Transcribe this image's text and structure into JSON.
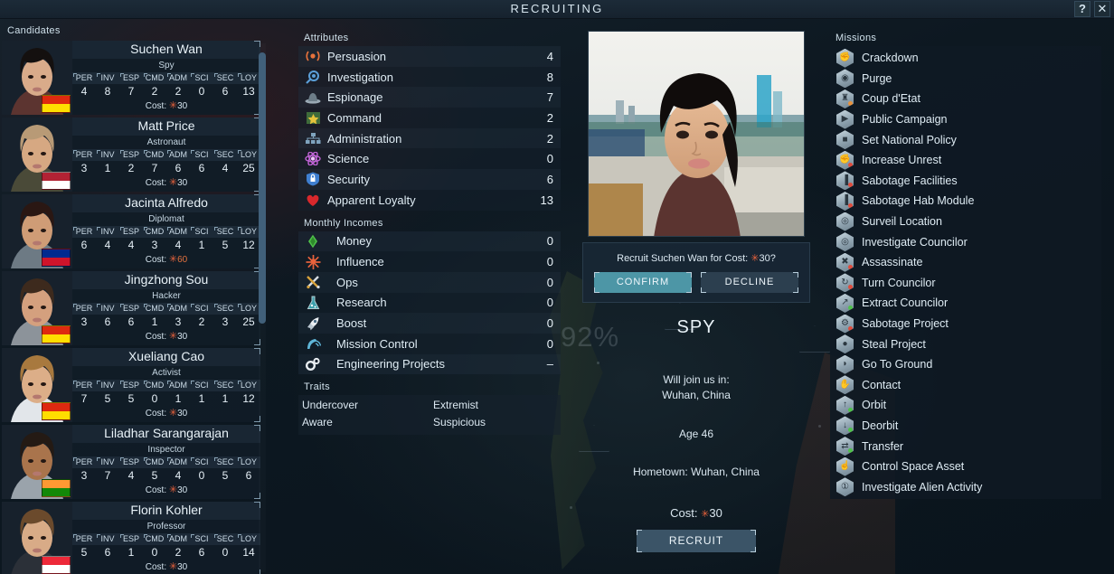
{
  "window": {
    "title": "RECRUITING",
    "help_label": "?",
    "close_label": "✕"
  },
  "candidates_panel": {
    "label": "Candidates",
    "cost_prefix": "Cost:",
    "stat_headers": [
      "PER",
      "INV",
      "ESP",
      "CMD",
      "ADM",
      "SCI",
      "SEC",
      "LOY"
    ],
    "items": [
      {
        "name": "Suchen Wan",
        "role": "Spy",
        "stats": [
          4,
          8,
          7,
          2,
          2,
          0,
          6,
          13
        ],
        "cost": "30",
        "cost_highlight": false,
        "flag": "China",
        "flag_colors": [
          "#de2910",
          "#ffde00"
        ],
        "hair": "#14100f",
        "skin": "#d9ab8a",
        "clothes": "#5c3430"
      },
      {
        "name": "Matt Price",
        "role": "Astronaut",
        "stats": [
          3,
          1,
          2,
          7,
          6,
          6,
          4,
          25
        ],
        "cost": "30",
        "cost_highlight": false,
        "flag": "United States",
        "flag_colors": [
          "#b22234",
          "#ffffff"
        ],
        "hair": "#b89a76",
        "skin": "#d6a882",
        "clothes": "#4a4a38"
      },
      {
        "name": "Jacinta Alfredo",
        "role": "Diplomat",
        "stats": [
          6,
          4,
          4,
          3,
          4,
          1,
          5,
          12
        ],
        "cost": "60",
        "cost_highlight": true,
        "flag": "Cuba",
        "flag_colors": [
          "#002a8f",
          "#cf142b"
        ],
        "hair": "#2a1713",
        "skin": "#cf9c76",
        "clothes": "#6d7a84"
      },
      {
        "name": "Jingzhong Sou",
        "role": "Hacker",
        "stats": [
          3,
          6,
          6,
          1,
          3,
          2,
          3,
          25
        ],
        "cost": "30",
        "cost_highlight": false,
        "flag": "China",
        "flag_colors": [
          "#de2910",
          "#ffde00"
        ],
        "hair": "#3d2a1d",
        "skin": "#d4a07e",
        "clothes": "#8c939a"
      },
      {
        "name": "Xueliang Cao",
        "role": "Activist",
        "stats": [
          7,
          5,
          5,
          0,
          1,
          1,
          1,
          12
        ],
        "cost": "30",
        "cost_highlight": false,
        "flag": "China",
        "flag_colors": [
          "#de2910",
          "#ffde00"
        ],
        "hair": "#a8793e",
        "skin": "#dcae88",
        "clothes": "#e2e6ea"
      },
      {
        "name": "Liladhar Sarangarajan",
        "role": "Inspector",
        "stats": [
          3,
          7,
          4,
          5,
          4,
          0,
          5,
          6
        ],
        "cost": "30",
        "cost_highlight": false,
        "flag": "India",
        "flag_colors": [
          "#ff9933",
          "#138808"
        ],
        "hair": "#241a14",
        "skin": "#a9744c",
        "clothes": "#9aa3ab"
      },
      {
        "name": "Florin Kohler",
        "role": "Professor",
        "stats": [
          5,
          6,
          1,
          0,
          2,
          6,
          0,
          14
        ],
        "cost": "30",
        "cost_highlight": false,
        "flag": "Austria",
        "flag_colors": [
          "#ed2939",
          "#ffffff"
        ],
        "hair": "#6b4a2c",
        "skin": "#d8ab87",
        "clothes": "#2b3038"
      }
    ]
  },
  "attributes_panel": {
    "label": "Attributes",
    "items": [
      {
        "name": "Persuasion",
        "value": 4,
        "icon": "broadcast-icon",
        "color": "#e8733c"
      },
      {
        "name": "Investigation",
        "value": 8,
        "icon": "magnifier-icon",
        "color": "#5b9fd8"
      },
      {
        "name": "Espionage",
        "value": 7,
        "icon": "spy-hat-icon",
        "color": "#9aa9b4"
      },
      {
        "name": "Command",
        "value": 2,
        "icon": "star-badge-icon",
        "color": "#e5c33c"
      },
      {
        "name": "Administration",
        "value": 2,
        "icon": "org-chart-icon",
        "color": "#7fa3bd"
      },
      {
        "name": "Science",
        "value": 0,
        "icon": "atom-icon",
        "color": "#c064d6"
      },
      {
        "name": "Security",
        "value": 6,
        "icon": "lock-shield-icon",
        "color": "#3f7fd0"
      },
      {
        "name": "Apparent Loyalty",
        "value": 13,
        "icon": "heart-icon",
        "color": "#d8282c"
      }
    ]
  },
  "incomes_panel": {
    "label": "Monthly Incomes",
    "items": [
      {
        "name": "Money",
        "value": "0",
        "icon": "money-icon",
        "color": "#4fc24a"
      },
      {
        "name": "Influence",
        "value": "0",
        "icon": "influence-star-icon",
        "color": "#e8623c"
      },
      {
        "name": "Ops",
        "value": "0",
        "icon": "crossed-blades-icon",
        "color": "#d8a23a"
      },
      {
        "name": "Research",
        "value": "0",
        "icon": "flask-icon",
        "color": "#44b8c4"
      },
      {
        "name": "Boost",
        "value": "0",
        "icon": "rocket-icon",
        "color": "#e9eef2"
      },
      {
        "name": "Mission Control",
        "value": "0",
        "icon": "satellite-dish-icon",
        "color": "#5fb6d8"
      },
      {
        "name": "Engineering Projects",
        "value": "–",
        "icon": "gears-icon",
        "color": "#e9eef2"
      }
    ]
  },
  "traits_panel": {
    "label": "Traits",
    "rows": [
      [
        "Undercover",
        "Extremist"
      ],
      [
        "Aware",
        "Suspicious"
      ]
    ]
  },
  "detail_panel": {
    "confirm_prompt_prefix": "Recruit Suchen Wan for Cost:",
    "confirm_prompt_cost": "30?",
    "confirm_label": "CONFIRM",
    "decline_label": "DECLINE",
    "role": "SPY",
    "join_label": "Will join us in:",
    "join_location": "Wuhan, China",
    "age": "Age 46",
    "hometown": "Hometown: Wuhan, China",
    "cost_label": "Cost:",
    "cost_value": "30",
    "recruit_label": "RECRUIT"
  },
  "missions_panel": {
    "label": "Missions",
    "items": [
      {
        "name": "Crackdown",
        "icon": "fist-hex-icon",
        "glyph": "✊",
        "dot": ""
      },
      {
        "name": "Purge",
        "icon": "purge-hex-icon",
        "glyph": "◉",
        "dot": ""
      },
      {
        "name": "Coup d'Etat",
        "icon": "coup-hex-icon",
        "glyph": "♜",
        "dot": "#e8923c"
      },
      {
        "name": "Public Campaign",
        "icon": "megaphone-hex-icon",
        "glyph": "▶",
        "dot": ""
      },
      {
        "name": "Set National Policy",
        "icon": "policy-hex-icon",
        "glyph": "■",
        "dot": ""
      },
      {
        "name": "Increase Unrest",
        "icon": "unrest-hex-icon",
        "glyph": "✊",
        "dot": "#e04b3c"
      },
      {
        "name": "Sabotage Facilities",
        "icon": "sabotage-facility-hex-icon",
        "glyph": "▐",
        "dot": "#e04b3c"
      },
      {
        "name": "Sabotage Hab Module",
        "icon": "sabotage-hab-hex-icon",
        "glyph": "▐",
        "dot": "#e04b3c"
      },
      {
        "name": "Surveil Location",
        "icon": "surveil-hex-icon",
        "glyph": "◎",
        "dot": ""
      },
      {
        "name": "Investigate Councilor",
        "icon": "investigate-hex-icon",
        "glyph": "◎",
        "dot": ""
      },
      {
        "name": "Assassinate",
        "icon": "assassinate-hex-icon",
        "glyph": "✖",
        "dot": "#e04b3c"
      },
      {
        "name": "Turn Councilor",
        "icon": "turn-hex-icon",
        "glyph": "↻",
        "dot": "#e04b3c"
      },
      {
        "name": "Extract Councilor",
        "icon": "extract-hex-icon",
        "glyph": "↗",
        "dot": "#4fc24a"
      },
      {
        "name": "Sabotage Project",
        "icon": "sabotage-project-hex-icon",
        "glyph": "⚙",
        "dot": "#e04b3c"
      },
      {
        "name": "Steal Project",
        "icon": "steal-hex-icon",
        "glyph": "●",
        "dot": ""
      },
      {
        "name": "Go To Ground",
        "icon": "go-to-ground-hex-icon",
        "glyph": "◗",
        "dot": ""
      },
      {
        "name": "Contact",
        "icon": "contact-hex-icon",
        "glyph": "✋",
        "dot": ""
      },
      {
        "name": "Orbit",
        "icon": "orbit-hex-icon",
        "glyph": "↑",
        "dot": "#4fc24a"
      },
      {
        "name": "Deorbit",
        "icon": "deorbit-hex-icon",
        "glyph": "↓",
        "dot": "#4fc24a"
      },
      {
        "name": "Transfer",
        "icon": "transfer-hex-icon",
        "glyph": "⇄",
        "dot": "#4fc24a"
      },
      {
        "name": "Control Space Asset",
        "icon": "control-space-hex-icon",
        "glyph": "☝",
        "dot": ""
      },
      {
        "name": "Investigate Alien Activity",
        "icon": "alien-activity-hex-icon",
        "glyph": "①",
        "dot": ""
      }
    ]
  },
  "background": {
    "map_percent": "92%"
  }
}
